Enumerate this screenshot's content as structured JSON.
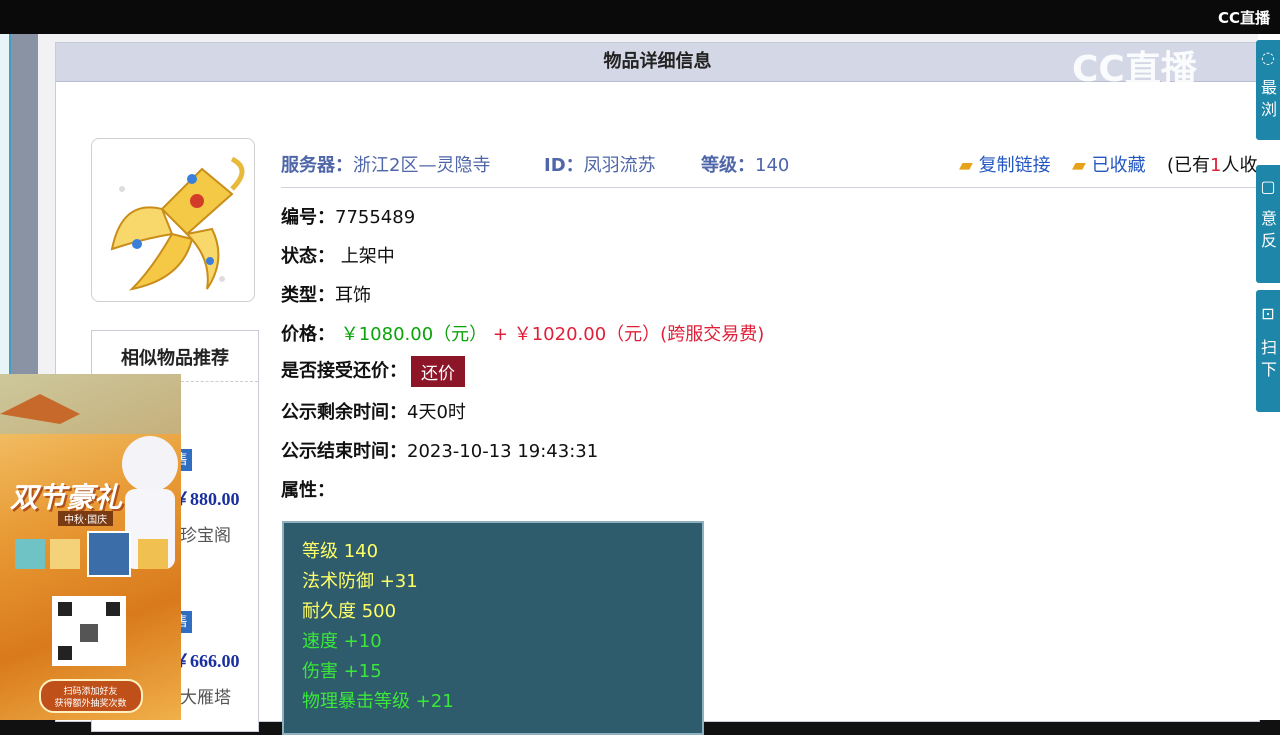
{
  "watermark": {
    "small": "CC直播",
    "big": "CC直播"
  },
  "panel": {
    "title": "物品详细信息"
  },
  "meta": {
    "server_label": "服务器：",
    "server_value": "浙江2区—灵隐寺",
    "id_label": "ID：",
    "id_value": "凤羽流苏",
    "level_label": "等级：",
    "level_value": "140",
    "copy_link": "复制链接",
    "favorited": "已收藏",
    "fav_count_prefix": "(已有",
    "fav_count": "1",
    "fav_count_suffix": "人收藏"
  },
  "fields": {
    "number_label": "编号：",
    "number_value": "7755489",
    "status_label": "状态：",
    "status_value": "上架中",
    "type_label": "类型：",
    "type_value": "耳饰",
    "price_label": "价格：",
    "price_value": "￥1080.00（元）",
    "price_plus": "+",
    "fee_value": "￥1020.00（元）(跨服交易费)",
    "bargain_label": "是否接受还价：",
    "bargain_button": "还价",
    "remain_label": "公示剩余时间：",
    "remain_value": "4天0时",
    "end_label": "公示结束时间：",
    "end_value": "2023-10-13 19:43:31",
    "attr_label": "属性："
  },
  "attributes": [
    {
      "text": "等级 140",
      "color": "#ffff66"
    },
    {
      "text": "法术防御 +31",
      "color": "#ffff66"
    },
    {
      "text": "耐久度 500",
      "color": "#ffff66"
    },
    {
      "text": "速度 +10",
      "color": "#39e839"
    },
    {
      "text": "伤害 +15",
      "color": "#39e839"
    },
    {
      "text": "物理暴击等级 +21",
      "color": "#39e839"
    }
  ],
  "similar": {
    "title": "相似物品推荐",
    "items": [
      {
        "tag": "售",
        "price": "￥880.00",
        "name": "珍宝阁"
      },
      {
        "tag": "售",
        "price": "￥666.00",
        "name": "大雁塔"
      }
    ]
  },
  "right_widgets": [
    {
      "icon": "clock-icon",
      "text": "最浏"
    },
    {
      "icon": "edit-icon",
      "text": "意反"
    },
    {
      "icon": "scan-icon",
      "text": "扫下"
    }
  ],
  "ad": {
    "headline": "双节豪礼",
    "sub": "中秋·国庆",
    "cta_line1": "扫码添加好友",
    "cta_line2": "获得额外抽奖次数"
  },
  "colors": {
    "accent_blue": "#4f66a8",
    "price_green": "#0aa30a",
    "fee_red": "#e0203a",
    "bargain_bg": "#8c1628",
    "attr_bg": "#2f5c6c"
  }
}
